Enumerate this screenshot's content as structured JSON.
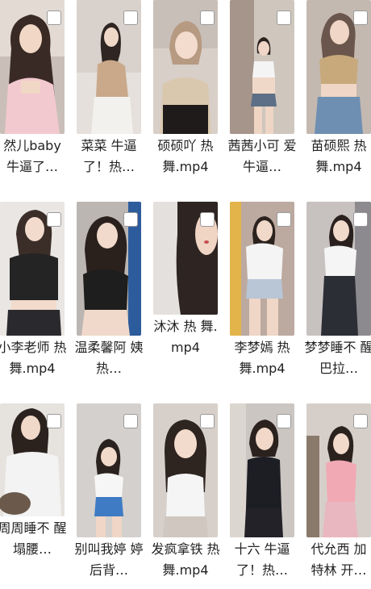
{
  "colors": {
    "background": "#ffffff",
    "caption_text": "#222222",
    "checkbox_border": "#9a9a9a"
  },
  "files": [
    {
      "caption": "然儿baby 牛逼了…",
      "selected": false
    },
    {
      "caption": "菜菜 牛逼 了！热…",
      "selected": false
    },
    {
      "caption": "硕硕吖 热 舞.mp4",
      "selected": false
    },
    {
      "caption": "茜茜小可 爱 牛逼…",
      "selected": false
    },
    {
      "caption": "苗硕熙 热 舞.mp4",
      "selected": false
    },
    {
      "caption": "小李老师 热舞.mp4",
      "selected": false
    },
    {
      "caption": "温柔馨阿 姨 热…",
      "selected": false
    },
    {
      "caption": "沐沐 热 舞.mp4",
      "selected": false
    },
    {
      "caption": "李梦嫣 热 舞.mp4",
      "selected": false
    },
    {
      "caption": "梦梦睡不 醒 巴拉…",
      "selected": false
    },
    {
      "caption": "周周睡不 醒 塌腰…",
      "selected": false
    },
    {
      "caption": "别叫我婷 婷 后背…",
      "selected": false
    },
    {
      "caption": "发疯拿铁 热舞.mp4",
      "selected": false
    },
    {
      "caption": "十六 牛逼 了！热…",
      "selected": false
    },
    {
      "caption": "代允西 加 特林 开…",
      "selected": false
    }
  ]
}
